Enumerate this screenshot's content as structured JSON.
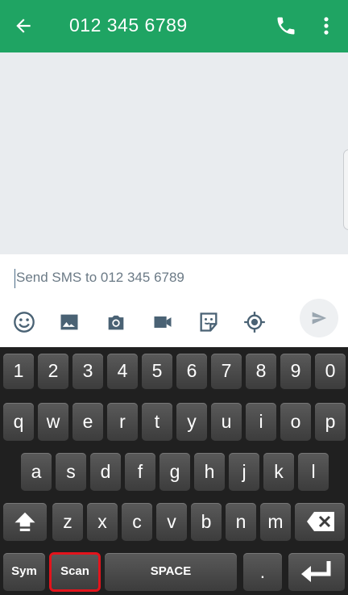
{
  "appbar": {
    "title": "012 345 6789",
    "back_icon": "arrow-back-icon",
    "call_icon": "phone-icon",
    "menu_icon": "more-vert-icon",
    "color": "#1fa463"
  },
  "composer": {
    "placeholder": "Send SMS to 012 345 6789",
    "tools": [
      "emoji-icon",
      "image-icon",
      "camera-icon",
      "video-icon",
      "sticker-icon",
      "location-icon"
    ],
    "send_icon": "send-icon"
  },
  "keyboard": {
    "numbers": [
      "1",
      "2",
      "3",
      "4",
      "5",
      "6",
      "7",
      "8",
      "9",
      "0"
    ],
    "row1": [
      "q",
      "w",
      "e",
      "r",
      "t",
      "y",
      "u",
      "i",
      "o",
      "p"
    ],
    "row2": [
      "a",
      "s",
      "d",
      "f",
      "g",
      "h",
      "j",
      "k",
      "l"
    ],
    "row3": [
      "z",
      "x",
      "c",
      "v",
      "b",
      "n",
      "m"
    ],
    "sym": "Sym",
    "scan": "Scan",
    "space": "SPACE",
    "period": ".",
    "highlight_color": "#e3141c"
  }
}
